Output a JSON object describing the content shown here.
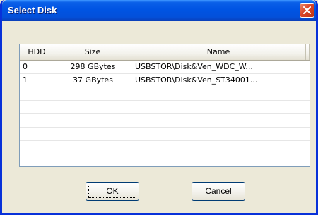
{
  "window": {
    "title": "Select Disk"
  },
  "table": {
    "columns": [
      "HDD",
      "Size",
      "Name"
    ],
    "rows": [
      {
        "hdd": "0",
        "size": "298 GBytes",
        "name": "USBSTOR\\Disk&Ven_WDC_W..."
      },
      {
        "hdd": "1",
        "size": "37 GBytes",
        "name": "USBSTOR\\Disk&Ven_ST34001..."
      }
    ]
  },
  "buttons": {
    "ok": "OK",
    "cancel": "Cancel"
  }
}
